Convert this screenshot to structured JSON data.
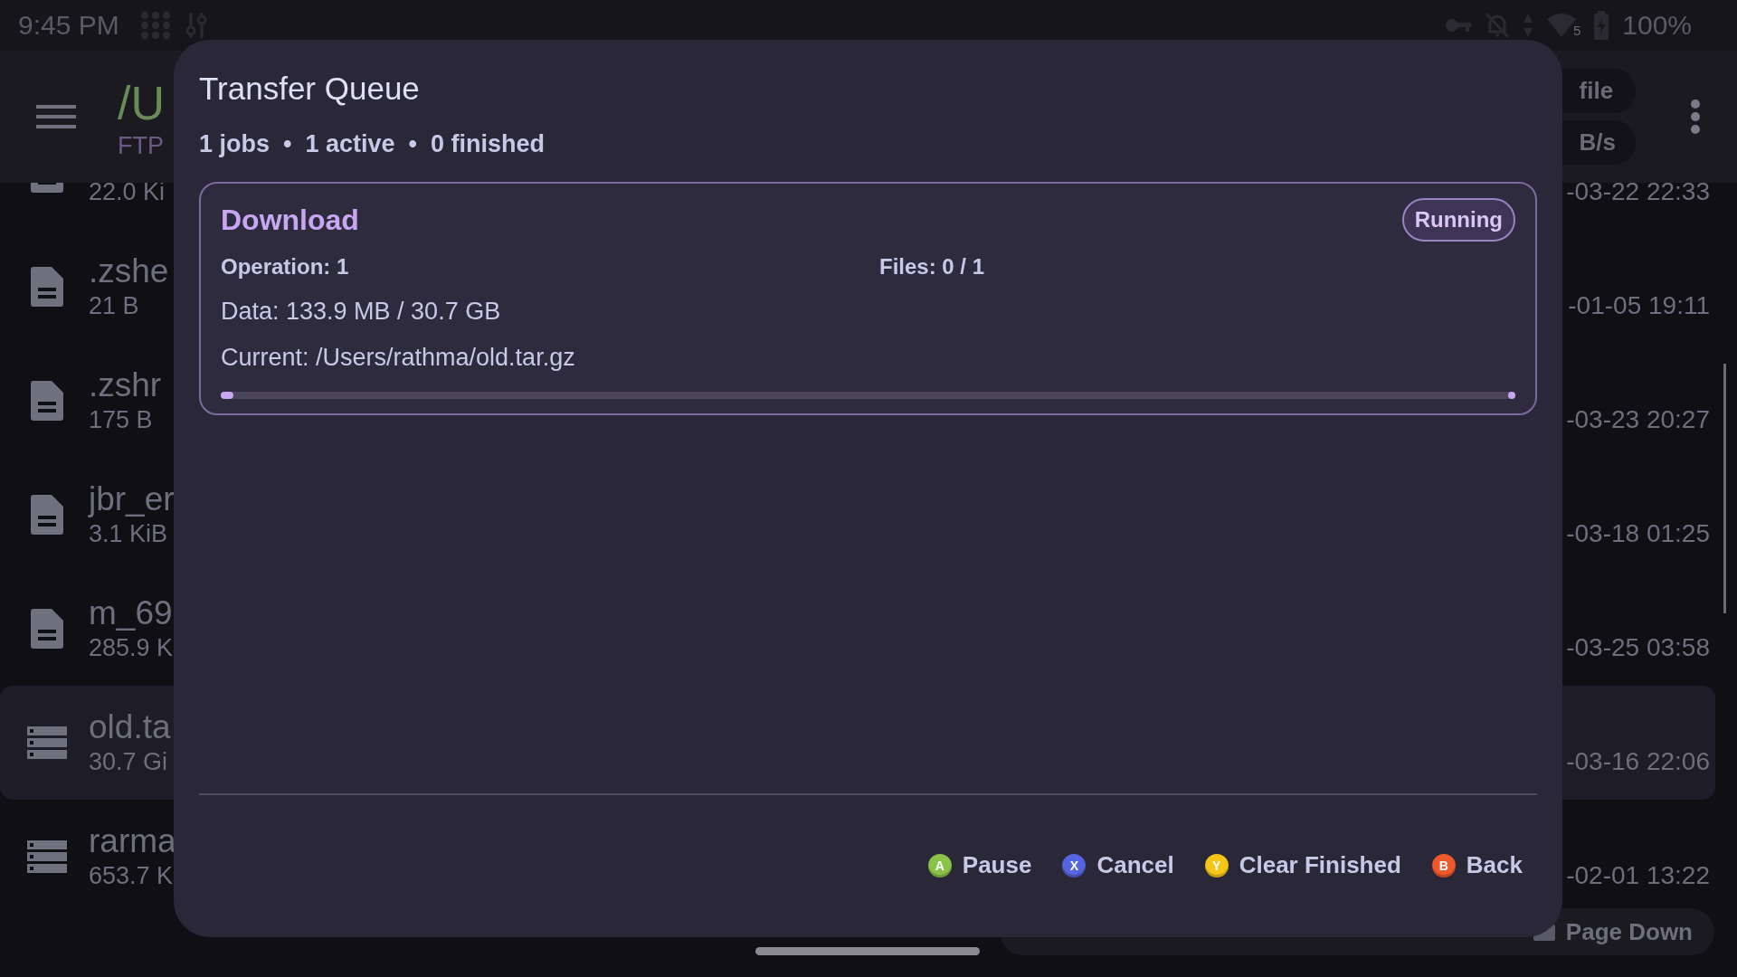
{
  "status_bar": {
    "time": "9:45 PM",
    "wifi_badge": "5",
    "battery": "100%"
  },
  "header": {
    "path": "/U",
    "subtitle": "FTP",
    "chips": [
      "file",
      "B/s"
    ]
  },
  "files": [
    {
      "size": "22.0 Ki",
      "date": "-03-22 22:33",
      "kind": "file",
      "selected": false
    },
    {
      "name": ".zshe",
      "size": "21 B",
      "date": "-01-05 19:11",
      "kind": "file",
      "selected": false
    },
    {
      "name": ".zshr",
      "size": "175 B",
      "date": "-03-23 20:27",
      "kind": "file",
      "selected": false
    },
    {
      "name": "jbr_er",
      "size": "3.1 KiB",
      "date": "-03-18 01:25",
      "kind": "file",
      "selected": false
    },
    {
      "name": "m_69",
      "size": "285.9 K",
      "date": "-03-25 03:58",
      "kind": "file",
      "selected": false
    },
    {
      "name": "old.ta",
      "size": "30.7 Gi",
      "date": "-03-16 22:06",
      "kind": "archive",
      "selected": true
    },
    {
      "name": "rarma",
      "size": "653.7 K",
      "date": "-02-01 13:22",
      "kind": "archive",
      "selected": false
    }
  ],
  "page_down": "Page Down",
  "dialog": {
    "title": "Transfer Queue",
    "summary": "1 jobs  •  1 active  •  0 finished",
    "jobs": [
      {
        "type": "Download",
        "status": "Running",
        "operation": "Operation: 1",
        "files": "Files: 0 / 1",
        "data": "Data: 133.9 MB / 30.7 GB",
        "current": "Current: /Users/rathma/old.tar.gz",
        "level": 0.004
      }
    ],
    "actions": [
      {
        "key": "A",
        "label": "Pause",
        "color": "#8bc34a"
      },
      {
        "key": "X",
        "label": "Cancel",
        "color": "#5566e0"
      },
      {
        "key": "Y",
        "label": "Clear Finished",
        "color": "#f5c518"
      },
      {
        "key": "B",
        "label": "Back",
        "color": "#ef5a2c"
      }
    ]
  }
}
